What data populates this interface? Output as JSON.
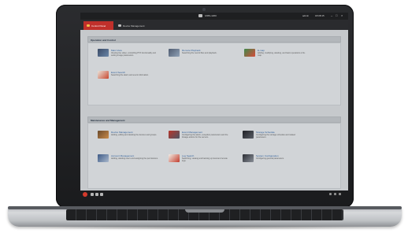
{
  "app": {
    "title": "iVMS-4200",
    "user": "admin",
    "time": "18:08:15"
  },
  "tabs": [
    {
      "label": "Control Panel"
    },
    {
      "label": "Device Management"
    }
  ],
  "sections": [
    {
      "title": "Operation and Control",
      "items": [
        {
          "name": "Main View",
          "desc": "Viewing live video, controlling PTZ functionality and setting image parameters.",
          "icon": "monitor-icon"
        },
        {
          "name": "Remote Playback",
          "desc": "Searching the record files and playback.",
          "icon": "playback-icon"
        },
        {
          "name": "E-map",
          "desc": "Adding, modifying, deleting, and basic operations of E-map.",
          "icon": "map-icon"
        },
        {
          "name": "Event Search",
          "desc": "Searching the alarm and event information.",
          "icon": "event-search-icon"
        }
      ]
    },
    {
      "title": "Maintenance and Management",
      "items": [
        {
          "name": "Device Management",
          "desc": "Adding, editing and deleting the devices and groups.",
          "icon": "device-icon"
        },
        {
          "name": "Event Management",
          "desc": "Configuring the alarm, exception parameters and the linkage actions for the servers.",
          "icon": "event-management-icon"
        },
        {
          "name": "Storage Schedule",
          "desc": "Configuring the storage schedule and related parameters.",
          "icon": "storage-icon"
        },
        {
          "name": "Account Management",
          "desc": "Adding, deleting users and assigning the permissions.",
          "icon": "account-icon"
        },
        {
          "name": "Log Search",
          "desc": "Searching, viewing and backing up local and remote logs.",
          "icon": "log-icon"
        },
        {
          "name": "System Configuration",
          "desc": "Configuring general parameters.",
          "icon": "settings-icon"
        }
      ]
    }
  ],
  "colors": {
    "accent": "#c0302b",
    "link": "#2f5f9a",
    "titlebar": "#1e1f21"
  }
}
